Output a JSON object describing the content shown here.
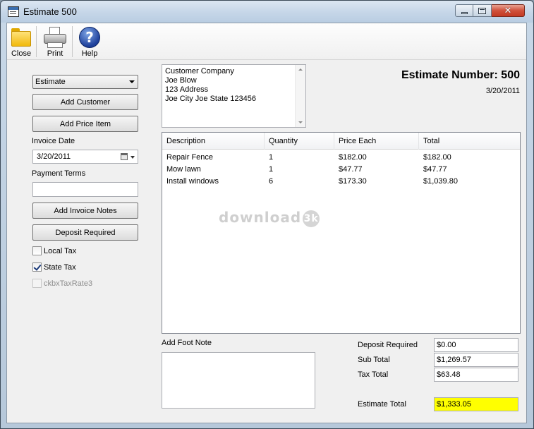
{
  "window": {
    "title": "Estimate 500"
  },
  "toolbar": {
    "close_label": "Close",
    "print_label": "Print",
    "help_label": "Help"
  },
  "left": {
    "doc_type": "Estimate",
    "add_customer": "Add Customer",
    "add_price_item": "Add Price Item",
    "invoice_date_label": "Invoice Date",
    "invoice_date": "3/20/2011",
    "payment_terms_label": "Payment Terms",
    "payment_terms": "",
    "add_invoice_notes": "Add Invoice Notes",
    "deposit_required": "Deposit Required",
    "local_tax": "Local Tax",
    "state_tax": "State Tax",
    "tax_rate3": "ckbxTaxRate3"
  },
  "customer": {
    "lines": [
      "Customer Company",
      "Joe Blow",
      "123 Address",
      "Joe City Joe State 123456"
    ]
  },
  "estimate": {
    "number_text": "Estimate Number: 500",
    "date": "3/20/2011"
  },
  "grid": {
    "headers": [
      "Description",
      "Quantity",
      "Price Each",
      "Total"
    ],
    "rows": [
      [
        "Repair Fence",
        "1",
        "$182.00",
        "$182.00"
      ],
      [
        "Mow lawn",
        "1",
        "$47.77",
        "$47.77"
      ],
      [
        "Install windows",
        "6",
        "$173.30",
        "$1,039.80"
      ]
    ],
    "watermark": "download",
    "watermark_badge": "3k"
  },
  "footer": {
    "foot_note_label": "Add Foot Note",
    "deposit_label": "Deposit Required",
    "deposit_value": "$0.00",
    "subtotal_label": "Sub Total",
    "subtotal_value": "$1,269.57",
    "tax_label": "Tax Total",
    "tax_value": "$63.48",
    "est_total_label": "Estimate Total",
    "est_total_value": "$1,333.05"
  },
  "colors": {
    "highlight": "#ffff00"
  }
}
